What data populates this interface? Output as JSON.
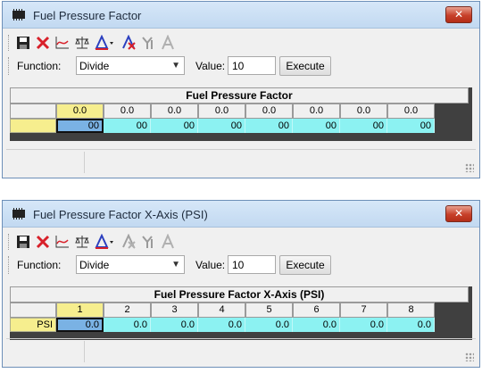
{
  "windows": [
    {
      "title": "Fuel Pressure Factor",
      "close_glyph": "✕",
      "function_label": "Function:",
      "function_value": "Divide",
      "value_label": "Value:",
      "value_value": "10",
      "execute_label": "Execute",
      "grid_title": "Fuel Pressure Factor",
      "row_header": "",
      "columns": [
        "0.0",
        "0.0",
        "0.0",
        "0.0",
        "0.0",
        "0.0",
        "0.0",
        "0.0"
      ],
      "cells": [
        "00",
        "00",
        "00",
        "00",
        "00",
        "00",
        "00",
        "00"
      ]
    },
    {
      "title": "Fuel Pressure Factor X-Axis (PSI)",
      "close_glyph": "✕",
      "function_label": "Function:",
      "function_value": "Divide",
      "value_label": "Value:",
      "value_value": "10",
      "execute_label": "Execute",
      "grid_title": "Fuel Pressure Factor X-Axis (PSI)",
      "row_header": "PSI",
      "columns": [
        "1",
        "2",
        "3",
        "4",
        "5",
        "6",
        "7",
        "8"
      ],
      "cells": [
        "0.0",
        "0.0",
        "0.0",
        "0.0",
        "0.0",
        "0.0",
        "0.0",
        "0.0"
      ]
    }
  ],
  "toolbar_icons": [
    "save-icon",
    "delete-icon",
    "graph-icon",
    "balance-icon",
    "interpolate-icon",
    "clear-icon",
    "smooth-icon",
    "text-icon"
  ],
  "colors": {
    "cell_bg": "#8cf2f2",
    "selected_cell_bg": "#7ab2e4",
    "header_highlight": "#f6ee8e",
    "close_red": "#c7402a"
  }
}
